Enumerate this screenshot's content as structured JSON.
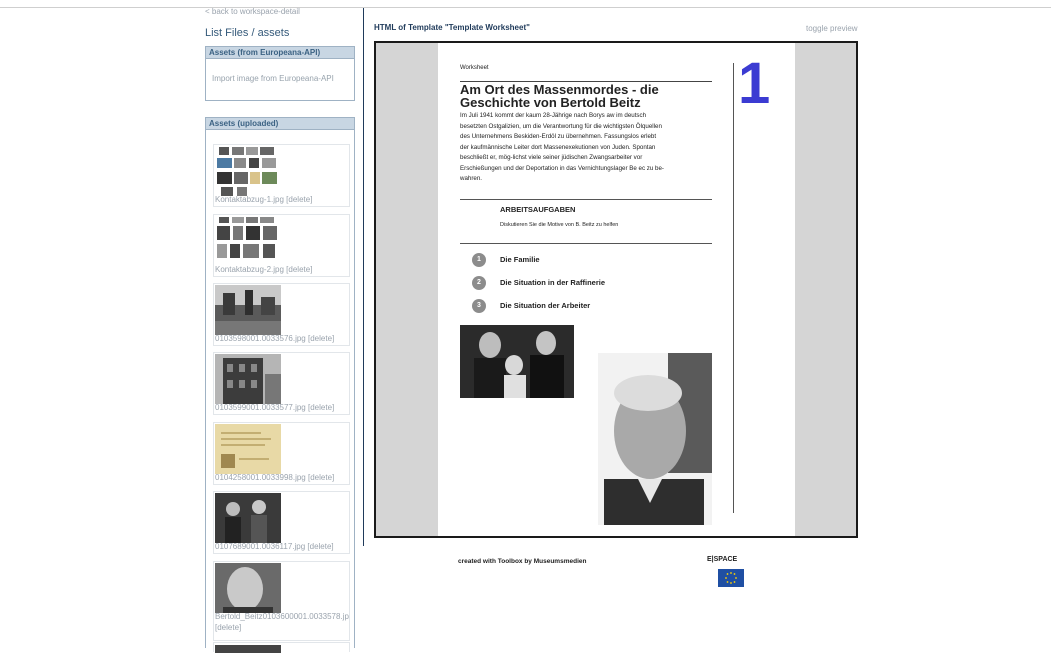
{
  "sidebar": {
    "back_link": "< back to workspace-detail",
    "title": "List Files / assets",
    "europeana_panel": {
      "header": "Assets (from Europeana-API)",
      "import_link": "Import image from Europeana-API"
    },
    "uploaded_panel": {
      "header": "Assets (uploaded)"
    },
    "delete_label": "[delete]",
    "assets": [
      {
        "filename": "Kontaktabzug-1.jpg"
      },
      {
        "filename": "Kontaktabzug-2.jpg"
      },
      {
        "filename": "0103598001.0033576.jpg"
      },
      {
        "filename": "0103599001.0033577.jpg"
      },
      {
        "filename": "0104258001.0033998.jpg"
      },
      {
        "filename": "0107689001.0036117.jpg"
      },
      {
        "filename": "Bertold_Beitz0103600001.0033578.jp"
      }
    ]
  },
  "main": {
    "title": "HTML of Template \"Template Worksheet\"",
    "toggle_label": "toggle preview"
  },
  "worksheet": {
    "label": "Worksheet",
    "big_number": "1",
    "title": "Am Ort des Massenmordes - die Geschichte von Bertold Beitz",
    "body": "Im Juli 1941 kommt der kaum 28-Jährige nach Borys aw im deutsch besetzten Ostgalizien, um die Verantwortung für die wichtigsten Ölquellen des Unternehmens Beskiden-Erdöl zu übernehmen. Fassungslos erlebt der kaufmännische Leiter dort Massenexekutionen von Juden. Spontan beschließt er, mög-lichst viele seiner jüdischen Zwangsarbeiter vor Erschießungen und der Deportation in das Vernichtungslager Be ec zu be-wahren.",
    "tasks_heading": "ARBEITSAUFGABEN",
    "tasks_sub": "Diskutieren Sie die Motive von B. Beitz zu helfen",
    "items": [
      {
        "num": "1",
        "text": "Die Familie"
      },
      {
        "num": "2",
        "text": "Die Situation in der Raffinerie"
      },
      {
        "num": "3",
        "text": "Die Situation der Arbeiter"
      }
    ]
  },
  "footer": {
    "credit": "created with Toolbox by Museumsmedien",
    "logo_text": "E|SPACE"
  },
  "colors": {
    "accent_number": "#3b3bd2",
    "panel_header_bg": "#c8d6e3",
    "title_blue": "#1f3a5a",
    "eu_blue": "#1f4fa3",
    "eu_stars": "#ffd400"
  }
}
